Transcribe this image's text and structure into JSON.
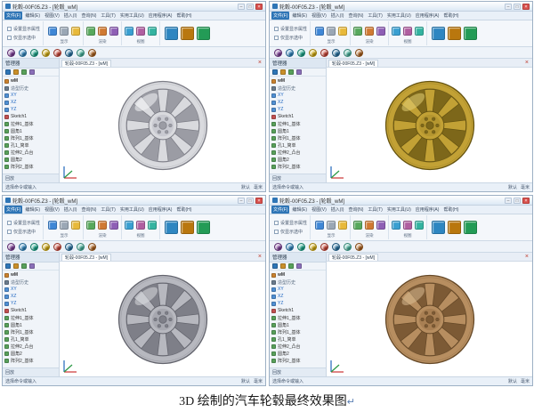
{
  "caption": {
    "text": "3D 绘制的汽车轮毂最终效果图",
    "mark": "↵"
  },
  "window": {
    "title": "轮毂-00F05.Z3 - [轮毂_wM]",
    "buttons": {
      "minimize": "–",
      "maximize": "□",
      "close": "×"
    },
    "menu_tabs": [
      "文件(F)",
      "编辑(E)",
      "视图(V)",
      "插入(I)",
      "查询(N)",
      "工具(T)",
      "实用工具(U)",
      "应用程序(A)",
      "帮助(H)"
    ],
    "ribbon": {
      "options": [
        {
          "label": "设置显示属性"
        },
        {
          "label": "仅显示选中"
        }
      ],
      "groups": [
        {
          "label": "显示",
          "icons": [
            {
              "name": "show-target-icon",
              "color": "#3f87d6"
            },
            {
              "name": "hide-target-icon",
              "color": "#9aa7b5"
            },
            {
              "name": "highlight-icon",
              "color": "#e8b93a"
            }
          ]
        },
        {
          "label": "渲染",
          "icons": [
            {
              "name": "shaded-render-icon",
              "color": "#57a85c"
            },
            {
              "name": "wireframe-icon",
              "color": "#d07a33"
            },
            {
              "name": "material-icon",
              "color": "#8e5fb5"
            }
          ]
        },
        {
          "label": "视图",
          "icons": [
            {
              "name": "iso-view-icon",
              "color": "#3a9fd1"
            },
            {
              "name": "camera-view-icon",
              "color": "#b05fa0"
            },
            {
              "name": "grid-view-icon",
              "color": "#34b3a0"
            }
          ]
        }
      ],
      "large_icons": [
        {
          "name": "render-image-icon",
          "color": "#2e86c1"
        },
        {
          "name": "scene-settings-icon",
          "color": "#b9770e"
        },
        {
          "name": "output-image-icon",
          "color": "#239b56"
        }
      ]
    },
    "view_toolbar": [
      {
        "name": "shade-mode-sphere-icon",
        "color": "#7d3c98"
      },
      {
        "name": "front-view-icon",
        "color": "#2e86c1"
      },
      {
        "name": "top-view-icon",
        "color": "#17a589"
      },
      {
        "name": "right-view-icon",
        "color": "#d4ac0d"
      },
      {
        "name": "iso-view-icon",
        "color": "#cb4335"
      },
      {
        "name": "rotate-view-icon",
        "color": "#2471a3"
      },
      {
        "name": "pan-view-icon",
        "color": "#45b39d"
      },
      {
        "name": "zoom-view-icon",
        "color": "#af601a"
      }
    ],
    "panel": {
      "title": "管理器",
      "tab_icons": [
        {
          "name": "history-tab-icon",
          "color": "#2e75b6"
        },
        {
          "name": "assembly-tab-icon",
          "color": "#c98f2a"
        },
        {
          "name": "layer-tab-icon",
          "color": "#58a05a"
        },
        {
          "name": "view-tab-icon",
          "color": "#8a6fb8"
        }
      ],
      "items": [
        {
          "label": "wM",
          "type": "root",
          "color": "#c9812f"
        },
        {
          "label": "造型历史",
          "type": "section",
          "color": "#6a7b8d"
        },
        {
          "label": "XY",
          "type": "plane",
          "color": "#4f8fd3"
        },
        {
          "label": "XZ",
          "type": "plane",
          "color": "#4f8fd3"
        },
        {
          "label": "YZ",
          "type": "plane",
          "color": "#4f8fd3"
        },
        {
          "label": "Sketch1",
          "type": "sketch",
          "color": "#c05050"
        },
        {
          "label": "拉伸1_基体",
          "type": "feature",
          "color": "#58a05a"
        },
        {
          "label": "圆角1",
          "type": "feature",
          "color": "#58a05a"
        },
        {
          "label": "阵列1_基体",
          "type": "feature",
          "color": "#58a05a"
        },
        {
          "label": "孔1_简单",
          "type": "feature",
          "color": "#58a05a"
        },
        {
          "label": "拉伸2_凸台",
          "type": "feature",
          "color": "#58a05a"
        },
        {
          "label": "圆角2",
          "type": "feature",
          "color": "#58a05a"
        },
        {
          "label": "阵列2_基体",
          "type": "feature",
          "color": "#58a05a"
        }
      ],
      "footer": "回放"
    },
    "doc_tab": "轮毂-00F05.Z3 - [wM]",
    "doc_close": "×",
    "status": {
      "left": "选择命令或输入",
      "mode": "默认",
      "units": "毫米"
    }
  },
  "windows": [
    {
      "style": "silver",
      "wheel": {
        "body": "#d9dade",
        "gap": "#9b9ca4",
        "edge": "#7c7d86",
        "hub": "#c9cad1",
        "highlight": "#f4f5f8"
      }
    },
    {
      "style": "gold",
      "wheel": {
        "body": "#c2a135",
        "gap": "#7d671a",
        "edge": "#665411",
        "hub": "#b59630",
        "highlight": "#e4cf74"
      }
    },
    {
      "style": "gray",
      "wheel": {
        "body": "#b7b8bf",
        "gap": "#7e7f88",
        "edge": "#63646d",
        "hub": "#a7a8b0",
        "highlight": "#d9dade"
      }
    },
    {
      "style": "bronze",
      "wheel": {
        "body": "#b78e60",
        "gap": "#7c5a35",
        "edge": "#654827",
        "hub": "#a87f53",
        "highlight": "#d9bb92"
      }
    }
  ]
}
